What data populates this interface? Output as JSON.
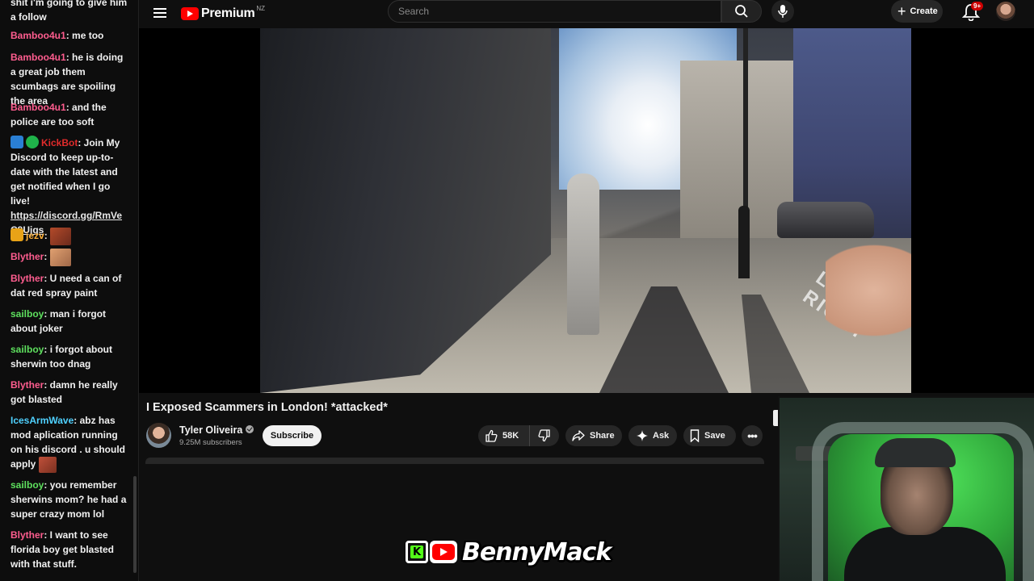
{
  "chat": {
    "messages": [
      {
        "user": "",
        "user_color": "#f1f1f1",
        "text": "shit i'm going to give him a follow"
      },
      {
        "user": "Bamboo4u1",
        "user_color": "#ff5d8f",
        "text": ": me too"
      },
      {
        "user": "Bamboo4u1",
        "user_color": "#ff5d8f",
        "text": ": he is doing a great job them scumbags are spoiling the area"
      },
      {
        "user": "Bamboo4u1",
        "user_color": "#ff5d8f",
        "text": ": and the police are too soft"
      },
      {
        "user": "KickBot",
        "user_color": "#e02b2b",
        "text": ": Join My Discord to keep up-to-date with the latest and get notified when I go live!",
        "link": "https://discord.gg/RmVeC9Ujqs"
      },
      {
        "user": "jezv",
        "user_color": "#ffb23b",
        "text": ":"
      },
      {
        "user": "Blyther",
        "user_color": "#ff5d8f",
        "text": ":"
      },
      {
        "user": "Blyther",
        "user_color": "#ff5d8f",
        "text": ": U need a can of dat red spray paint"
      },
      {
        "user": "sailboy",
        "user_color": "#5ee05e",
        "text": ": man i forgot about joker"
      },
      {
        "user": "sailboy",
        "user_color": "#5ee05e",
        "text": ": i forgot about sherwin too dnag"
      },
      {
        "user": "Blyther",
        "user_color": "#ff5d8f",
        "text": ": damn he really got blasted"
      },
      {
        "user": "IcesArmWave",
        "user_color": "#4fd1ff",
        "text": ": abz has mod aplication running on his discord . u should apply"
      },
      {
        "user": "sailboy",
        "user_color": "#5ee05e",
        "text": ": you remember sherwins mom? he had a super crazy mom lol"
      },
      {
        "user": "Blyther",
        "user_color": "#ff5d8f",
        "text": ": I want to see florida boy get blasted with that stuff."
      }
    ]
  },
  "topbar": {
    "logo_text": "Premium",
    "logo_region": "NZ",
    "search_placeholder": "Search",
    "create_label": "Create",
    "notifications_badge": "9+"
  },
  "video": {
    "street_text": "LOOK RIGHT"
  },
  "info": {
    "title": "I Exposed Scammers in London! *attacked*",
    "channel_name": "Tyler Oliveira",
    "subscribers": "9.25M subscribers",
    "subscribe_label": "Subscribe",
    "like_count": "58K",
    "share_label": "Share",
    "ask_label": "Ask",
    "save_label": "Save"
  },
  "watermark": {
    "kick_letter": "K",
    "name": "BennyMack"
  },
  "colors": {
    "youtube_red": "#ff0000",
    "kick_green": "#53fc18",
    "background": "#0f0f0f"
  }
}
